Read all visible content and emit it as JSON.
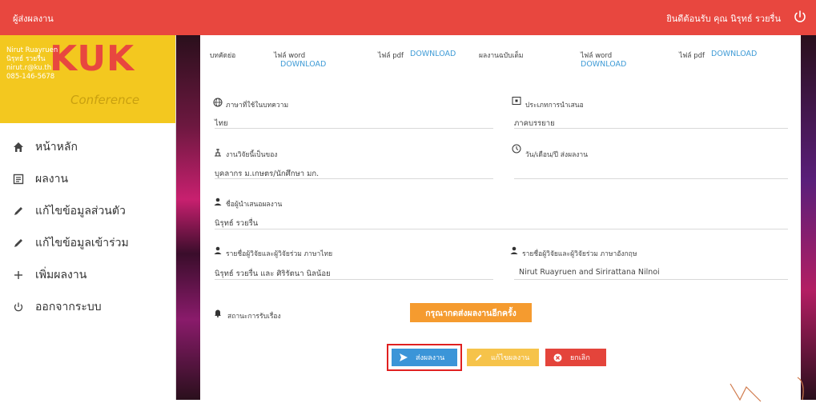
{
  "header": {
    "title": "ผู้ส่งผลงาน",
    "welcome": "ยินดีต้อนรับ คุณ นิรุทธ์ รวยรื่น"
  },
  "profile": {
    "name_en": "Nirut Ruayruen",
    "name_th": "นิรุทธ์ รวยรื่น",
    "email": "nirut.r@ku.th",
    "phone": "085-146-5678",
    "logo_text": "KUK",
    "logo_sub": "Conference"
  },
  "sidebar": {
    "items": [
      {
        "label": "หน้าหลัก",
        "icon": "home-icon"
      },
      {
        "label": "ผลงาน",
        "icon": "document-icon"
      },
      {
        "label": "แก้ไขข้อมูลส่วนตัว",
        "icon": "pencil-icon"
      },
      {
        "label": "แก้ไขข้อมูลเข้าร่วม",
        "icon": "pencil-icon"
      },
      {
        "label": "เพิ่มผลงาน",
        "icon": "plus-icon"
      },
      {
        "label": "ออกจากระบบ",
        "icon": "power-icon"
      }
    ]
  },
  "files": {
    "abstract_label": "บทคัดย่อ",
    "word_label": "ไฟล์ word",
    "pdf_label": "ไฟล์ pdf",
    "download": "DOWNLOAD",
    "full_label": "ผลงานฉบับเต็ม"
  },
  "fields": {
    "language_label": "ภาษาที่ใช้ในบทความ",
    "language_value": "ไทย",
    "presentation_label": "ประเภทการนำเสนอ",
    "presentation_value": "ภาคบรรยาย",
    "owner_label": "งานวิจัยนี้เป็นของ",
    "owner_value": "บุคลากร ม.เกษตร/นักศึกษา มก.",
    "date_label": "วัน/เดือน/ปี ส่งผลงาน",
    "date_value": "",
    "presenter_label": "ชื่อผู้นำเสนอผลงาน",
    "presenter_value": "นิรุทธ์ รวยรื่น",
    "coauthors_th_label": "รายชื่อผู้วิจัยและผู้วิจัยร่วม ภาษาไทย",
    "coauthors_th_value": "นิรุทธ์ รวยรื่น และ ศิริรัตนา นิลน้อย",
    "coauthors_en_label": "รายชื่อผู้วิจัยและผู้วิจัยร่วม ภาษาอังกฤษ",
    "coauthors_en_value": "Nirut Ruayruen and Sirirattana Nilnoi",
    "status_label": "สถานะการรับเรื่อง",
    "status_notice": "กรุณากดส่งผลงานอีกครั้ง"
  },
  "actions": {
    "submit": "ส่งผลงาน",
    "edit": "แก้ไขผลงาน",
    "cancel": "ยกเลิก"
  },
  "colors": {
    "header": "#e8473f",
    "profile_bg": "#f3c81f",
    "link": "#3f9bd6",
    "submit": "#3b95d8",
    "edit": "#f6c34a",
    "cancel": "#e4443b",
    "notice": "#f59b2f",
    "highlight": "#e02020"
  }
}
